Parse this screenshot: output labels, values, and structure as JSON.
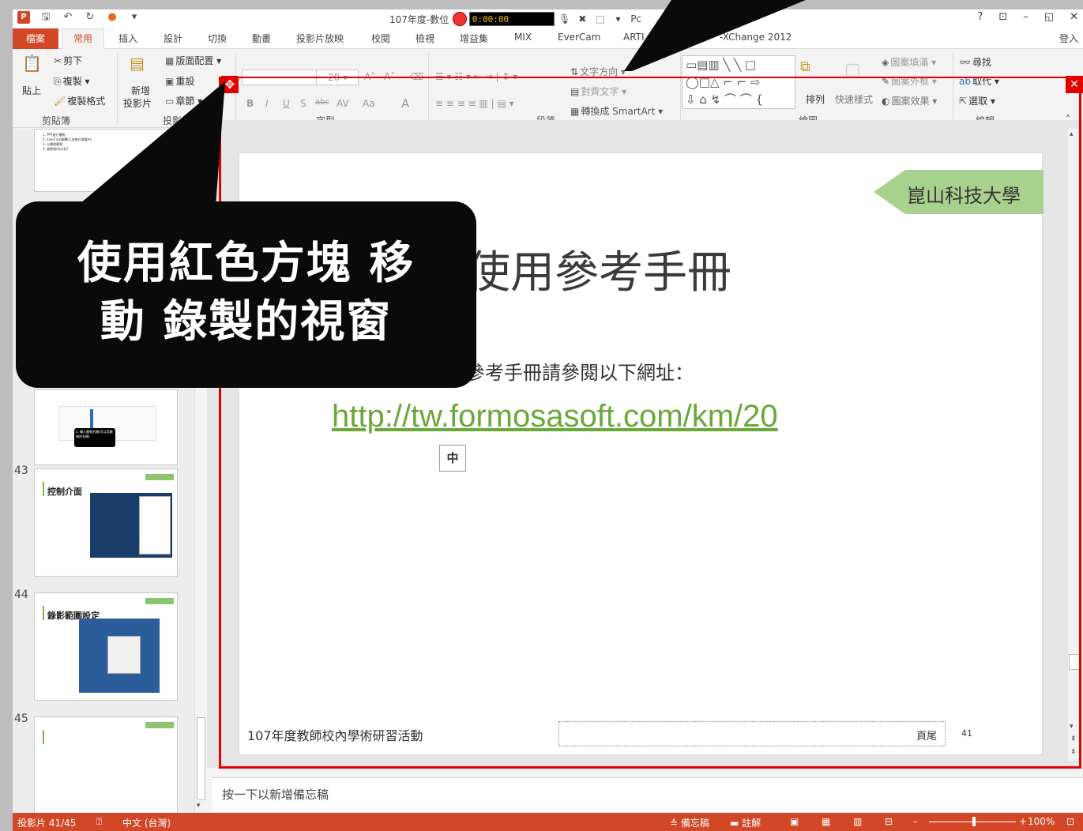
{
  "titlebar": {
    "doc_title": "107年度-數位",
    "rec_time": "0:00:00",
    "rec_extra": "Pc",
    "help": "?",
    "ribbon_display": "⊡",
    "minimize": "–",
    "restore": "◱",
    "close": "✕"
  },
  "tabs": [
    "檔案",
    "常用",
    "插入",
    "設計",
    "切換",
    "動畫",
    "投影片放映",
    "校閱",
    "檢視",
    "增益集",
    "MIX",
    "EverCam",
    "ARTI",
    "-XChange 2012"
  ],
  "login": "登入",
  "ribbon": {
    "clipboard": {
      "paste": "貼上",
      "cut": "剪下",
      "copy": "複製",
      "format_painter": "複製格式",
      "label": "剪貼簿"
    },
    "slides": {
      "new_slide_line1": "新增",
      "new_slide_line2": "投影片",
      "layout": "版面配置",
      "reset": "重設",
      "section": "章節",
      "label": "投影片"
    },
    "font": {
      "size": "20",
      "label": "字型",
      "bold": "B",
      "italic": "I",
      "underline": "U",
      "shadow": "S",
      "strike": "abc",
      "spacing": "AV",
      "case": "Aa",
      "color": "A"
    },
    "paragraph": {
      "text_direction": "文字方向",
      "align_text": "對齊文字",
      "smartart": "轉換成 SmartArt",
      "label": "段落"
    },
    "drawing": {
      "arrange": "排列",
      "quick_styles": "快速樣式",
      "fill": "圖案填滿",
      "outline": "圖案外框",
      "effects": "圖案效果",
      "label": "繪圖"
    },
    "editing": {
      "find": "尋找",
      "replace": "取代",
      "select": "選取",
      "label": "編輯"
    }
  },
  "thumbnails": [
    {
      "num": "43",
      "title": "控制介面"
    },
    {
      "num": "44",
      "title": "錄影範圍設定"
    },
    {
      "num": "45",
      "title": ""
    }
  ],
  "thumb_top_text": [
    "1. PPT進行播報",
    "2. EverCam軟體(已安裝在電腦中)",
    "3. 以播放簡報",
    "4. 錄影後(的分析)"
  ],
  "thumb_callout": "2. 輸入簡報名稱(可以用簡報的名稱)",
  "slide": {
    "tag": "崑山科技大學",
    "title": "使用參考手冊",
    "body": "參考手冊請參閱以下網址：",
    "link": "http://tw.formosasoft.com/km/20",
    "ime": "中",
    "footer_left": "107年度教師校內學術研習活動",
    "footer_center": "頁尾",
    "footer_num": "41"
  },
  "notes_placeholder": "按一下以新增備忘稿",
  "status": {
    "slide_count": "投影片 41/45",
    "language": "中文 (台灣)",
    "notes": "備忘稿",
    "comments": "註解",
    "zoom": "100%"
  },
  "callout": {
    "line1": "使用紅色方塊 移",
    "line2": "動 錄製的視窗"
  },
  "colors": {
    "accent": "#d24726",
    "record_frame": "#e30000",
    "link": "#6aa83a",
    "tag": "#a9d18e"
  }
}
